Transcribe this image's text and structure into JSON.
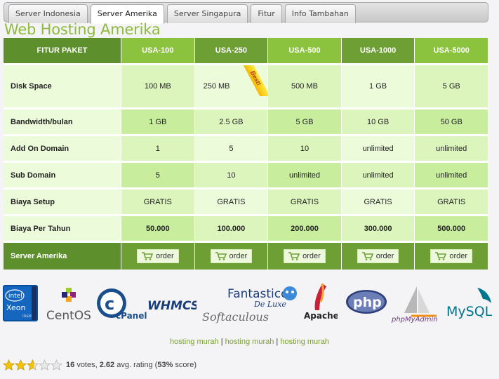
{
  "tabs": [
    "Server Indonesia",
    "Server Amerika",
    "Server Singapura",
    "Fitur",
    "Info Tambahan"
  ],
  "active_tab": "Server Amerika",
  "heading": "Web Hosting Amerika",
  "table": {
    "header_feature": "FITUR PAKET",
    "packages": [
      "USA-100",
      "USA-250",
      "USA-500",
      "USA-1000",
      "USA-5000"
    ],
    "rows": [
      {
        "label": "Disk Space",
        "values": [
          "100 MB",
          "250 MB",
          "500 MB",
          "1 GB",
          "5 GB"
        ]
      },
      {
        "label": "Bandwidth/bulan",
        "values": [
          "1 GB",
          "2.5 GB",
          "5 GB",
          "10 GB",
          "50 GB"
        ]
      },
      {
        "label": "Add On Domain",
        "values": [
          "1",
          "5",
          "10",
          "unlimited",
          "unlimited"
        ]
      },
      {
        "label": "Sub Domain",
        "values": [
          "5",
          "10",
          "unlimited",
          "unlimited",
          "unlimited"
        ]
      },
      {
        "label": "Biaya Setup",
        "values": [
          "GRATIS",
          "GRATIS",
          "GRATIS",
          "GRATIS",
          "GRATIS"
        ]
      },
      {
        "label": "Biaya Per Tahun",
        "values": [
          "50.000",
          "100.000",
          "200.000",
          "300.000",
          "500.000"
        ]
      }
    ],
    "footer_label": "Server Amerika",
    "order_label": "order",
    "best_badge": "Best!"
  },
  "logos": {
    "intel_top": "intel",
    "intel_bottom": "Xeon",
    "intel_small": "inside",
    "centos": "CentOS",
    "cpanel": "cPanel",
    "whmcs": "WHMCS",
    "fantastico": "Fantastico",
    "deluxe": "De Luxe",
    "softaculous": "Softaculous",
    "apache": "Apache",
    "php": "php",
    "phpmyadmin": "phpMyAdmin",
    "mysql": "MySQL"
  },
  "links": {
    "items": [
      "hosting murah",
      "hosting murah",
      "hosting murah"
    ],
    "separator": "|"
  },
  "rating": {
    "votes_number": "16",
    "votes_label": "votes,",
    "avg_number": "2.62",
    "avg_label": "avg. rating",
    "score_number": "53%",
    "score_label": "score",
    "stars_value": 2.62,
    "stars_max": 5
  },
  "colors": {
    "heading": "#8fba3c",
    "header_dark": "#5d8f2c",
    "header_light": "#8bc33e",
    "cell_light": "#dcf5bd",
    "cell_dark": "#c8ed9c",
    "star": "#f5c400"
  }
}
